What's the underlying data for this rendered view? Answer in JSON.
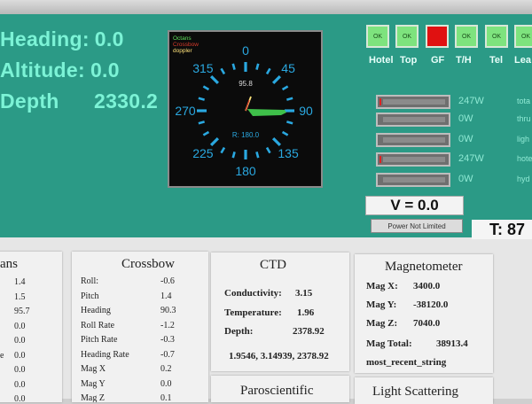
{
  "nav": {
    "heading_label": "Heading:",
    "heading_value": "0.0",
    "altitude_label": "Altitude:",
    "altitude_value": "0.0",
    "depth_label": "Depth",
    "depth_value": "2330.2"
  },
  "compass": {
    "legend": [
      "Octans",
      "Crossbow",
      "doppler"
    ],
    "legend_colors": [
      "#5ee05e",
      "#d83b2c",
      "#ffe27a"
    ],
    "labels": [
      "0",
      "45",
      "90",
      "135",
      "180",
      "225",
      "270",
      "315"
    ],
    "center_top": "95.8",
    "center_bottom": "R: 180.0",
    "tick_color": "#2aa8e0",
    "needle_color": "#3fc04a"
  },
  "status": {
    "buttons": [
      {
        "text": "OK",
        "label": "Hotel",
        "state": "ok"
      },
      {
        "text": "OK",
        "label": "Top",
        "state": "ok"
      },
      {
        "text": "",
        "label": "GF",
        "state": "fault"
      },
      {
        "text": "OK",
        "label": "T/H",
        "state": "ok"
      },
      {
        "text": "OK",
        "label": "Tel",
        "state": "ok"
      },
      {
        "text": "OK",
        "label": "Lea",
        "state": "ok"
      }
    ]
  },
  "power": {
    "rows": [
      {
        "value": "247W",
        "name": "tota",
        "level": 0.03
      },
      {
        "value": "0W",
        "name": "thru",
        "level": 0
      },
      {
        "value": "0W",
        "name": "ligh",
        "level": 0
      },
      {
        "value": "247W",
        "name": "hote",
        "level": 0.03
      },
      {
        "value": "0W",
        "name": "hyd",
        "level": 0
      }
    ],
    "voltage": "V = 0.0",
    "power_status": "Power Not Limited",
    "temperature": "T: 87"
  },
  "cards": {
    "partial": {
      "title": "ans",
      "rows": [
        {
          "label": "",
          "value": "1.4"
        },
        {
          "label": "",
          "value": "1.5"
        },
        {
          "label": "",
          "value": "95.7"
        },
        {
          "label": "",
          "value": "0.0"
        },
        {
          "label": "",
          "value": "0.0"
        },
        {
          "label": "e",
          "value": "0.0"
        },
        {
          "label": "",
          "value": "0.0"
        },
        {
          "label": "",
          "value": "0.0"
        },
        {
          "label": "",
          "value": "0.0"
        }
      ]
    },
    "crossbow": {
      "title": "Crossbow",
      "rows": [
        {
          "label": "Roll:",
          "value": "-0.6"
        },
        {
          "label": "Pitch",
          "value": "1.4"
        },
        {
          "label": "Heading",
          "value": "90.3"
        },
        {
          "label": "Roll Rate",
          "value": "-1.2"
        },
        {
          "label": "Pitch Rate",
          "value": "-0.3"
        },
        {
          "label": "Heading Rate",
          "value": "-0.7"
        },
        {
          "label": "Mag X",
          "value": "0.2"
        },
        {
          "label": "Mag Y",
          "value": "0.0"
        },
        {
          "label": "Mag Z",
          "value": "0.1"
        }
      ]
    },
    "ctd": {
      "title": "CTD",
      "conductivity_label": "Conductivity:",
      "conductivity_value": "3.15",
      "temperature_label": "Temperature:",
      "temperature_value": "1.96",
      "depth_label": "Depth:",
      "depth_value": "2378.92",
      "raw": "1.9546, 3.14939, 2378.92"
    },
    "paroscientific": {
      "title": "Paroscientific"
    },
    "magnetometer": {
      "title": "Magnetometer",
      "magx_label": "Mag X:",
      "magx_value": "3400.0",
      "magy_label": "Mag Y:",
      "magy_value": "-38120.0",
      "magz_label": "Mag Z:",
      "magz_value": "7040.0",
      "total_label": "Mag Total:",
      "total_value": "38913.4",
      "recent": "most_recent_string"
    },
    "light_scattering": {
      "title": "Light Scattering"
    }
  }
}
